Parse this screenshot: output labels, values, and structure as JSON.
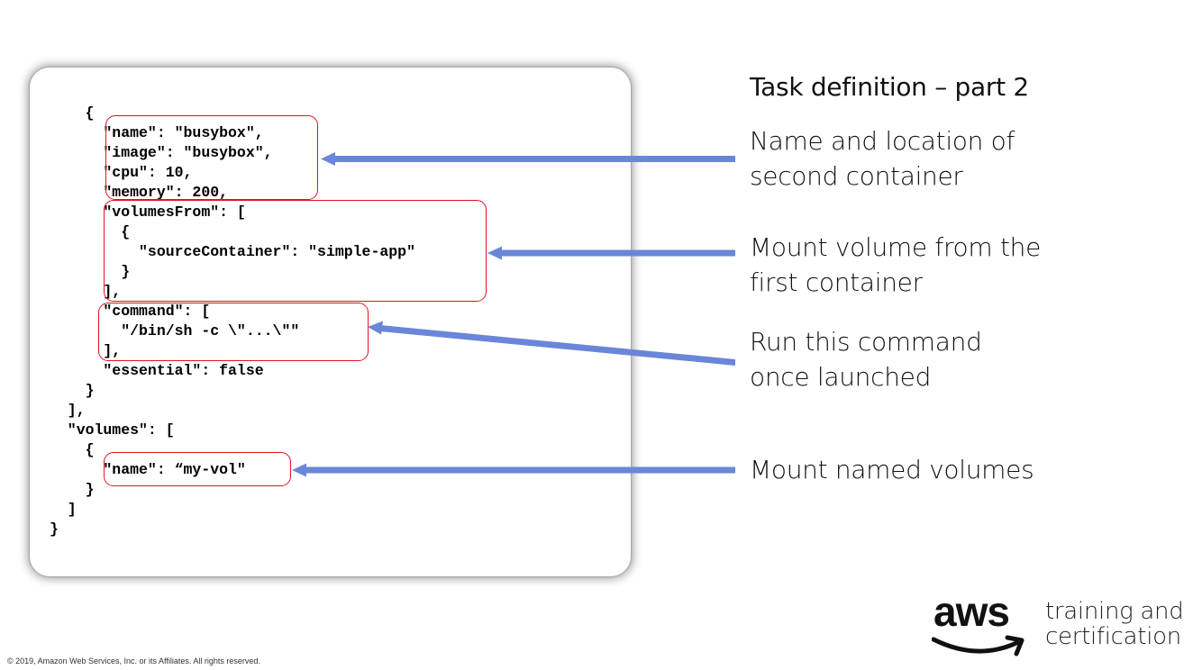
{
  "code_lines": [
    "    {",
    "      \"name\": \"busybox\",",
    "      \"image\": \"busybox\",",
    "      \"cpu\": 10,",
    "      \"memory\": 200,",
    "      \"volumesFrom\": [",
    "        {",
    "          \"sourceContainer\": \"simple-app\"",
    "        }",
    "      ],",
    "      \"command\": [",
    "        \"/bin/sh -c \\\"...\\\"\"",
    "      ],",
    "      \"essential\": false",
    "    }",
    "  ],",
    "  \"volumes\": [",
    "    {",
    "      \"name\": “my-vol\"",
    "    }",
    "  ]",
    "}"
  ],
  "title": "Task definition – part 2",
  "notes": [
    {
      "line1": "Name and location of",
      "line2": "second container"
    },
    {
      "line1": "Mount volume from the",
      "line2": "first container"
    },
    {
      "line1": "Run this command",
      "line2": "once launched"
    },
    {
      "line1": "Mount named volumes",
      "line2": ""
    }
  ],
  "colors": {
    "highlight_box": "#e0141e",
    "arrow": "#6a86d8"
  },
  "brand": {
    "logo_text": "aws",
    "line1": "training and",
    "line2": "certification"
  },
  "footer": "© 2019, Amazon Web Services, Inc. or its Affiliates. All rights reserved."
}
